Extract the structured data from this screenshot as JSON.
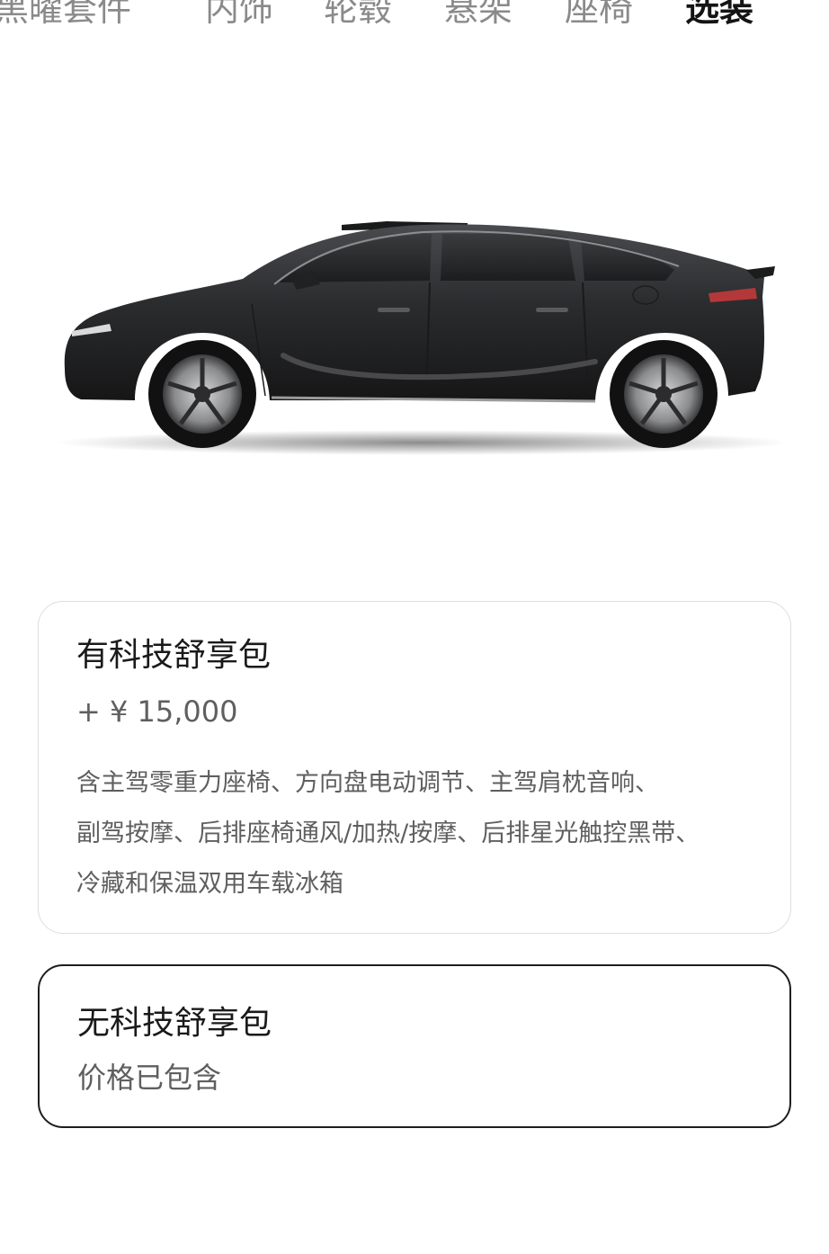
{
  "tabs": [
    {
      "label": "黑曜套件",
      "active": false
    },
    {
      "label": "内饰",
      "active": false
    },
    {
      "label": "轮毂",
      "active": false
    },
    {
      "label": "悬架",
      "active": false
    },
    {
      "label": "座椅",
      "active": false
    },
    {
      "label": "选装",
      "active": true
    }
  ],
  "car_image": {
    "subject": "dark-grey-suv-side-view",
    "body_color": "#2b2c2e"
  },
  "options": [
    {
      "title": "有科技舒享包",
      "price": "+ ¥ 15,000",
      "description_lines": [
        "含主驾零重力座椅、方向盘电动调节、主驾肩枕音响、",
        "副驾按摩、后排座椅通风/加热/按摩、后排星光触控黑带、",
        "冷藏和保温双用车载冰箱"
      ],
      "selected": false
    },
    {
      "title": "无科技舒享包",
      "price_note": "价格已包含",
      "selected": true
    }
  ],
  "colors": {
    "selected_border": "#1e1e1e",
    "unselected_border": "#dedede",
    "secondary_text": "#5f5f5f",
    "inactive_tab": "#8a8a8a"
  }
}
